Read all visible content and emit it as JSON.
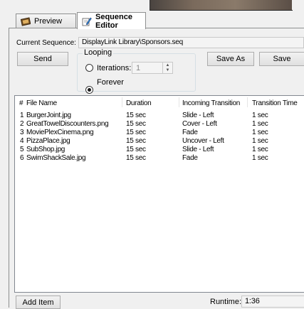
{
  "tabs": [
    {
      "label": "Preview",
      "active": false
    },
    {
      "label": "Sequence Editor",
      "active": true
    }
  ],
  "current_sequence": {
    "label": "Current Sequence:",
    "value": "DisplayLink Library\\Sponsors.seq"
  },
  "buttons": {
    "send": "Send",
    "save_as": "Save As",
    "save": "Save",
    "add_item": "Add Item"
  },
  "looping": {
    "title": "Looping",
    "iterations_label": "Iterations:",
    "iterations_value": "1",
    "forever_label": "Forever",
    "selected": "forever"
  },
  "table": {
    "columns": [
      "#",
      "File Name",
      "Duration",
      "Incoming Transition",
      "Transition Time"
    ],
    "rows": [
      {
        "num": "1",
        "file": "BurgerJoint.jpg",
        "duration": "15 sec",
        "transition": "Slide - Left",
        "time": "1 sec"
      },
      {
        "num": "2",
        "file": "GreatTowelDiscounters.png",
        "duration": "15 sec",
        "transition": "Cover - Left",
        "time": "1 sec"
      },
      {
        "num": "3",
        "file": "MoviePlexCinema.png",
        "duration": "15 sec",
        "transition": "Fade",
        "time": "1 sec"
      },
      {
        "num": "4",
        "file": "PizzaPlace.jpg",
        "duration": "15 sec",
        "transition": "Uncover - Left",
        "time": "1 sec"
      },
      {
        "num": "5",
        "file": "SubShop.jpg",
        "duration": "15 sec",
        "transition": "Slide - Left",
        "time": "1 sec"
      },
      {
        "num": "6",
        "file": "SwimShackSale.jpg",
        "duration": "15 sec",
        "transition": "Fade",
        "time": "1 sec"
      }
    ]
  },
  "runtime": {
    "label": "Runtime:",
    "value": "1:36"
  },
  "icons": {
    "preview_tab": "film-strip-icon",
    "sequence_tab": "edit-pencil-icon"
  }
}
